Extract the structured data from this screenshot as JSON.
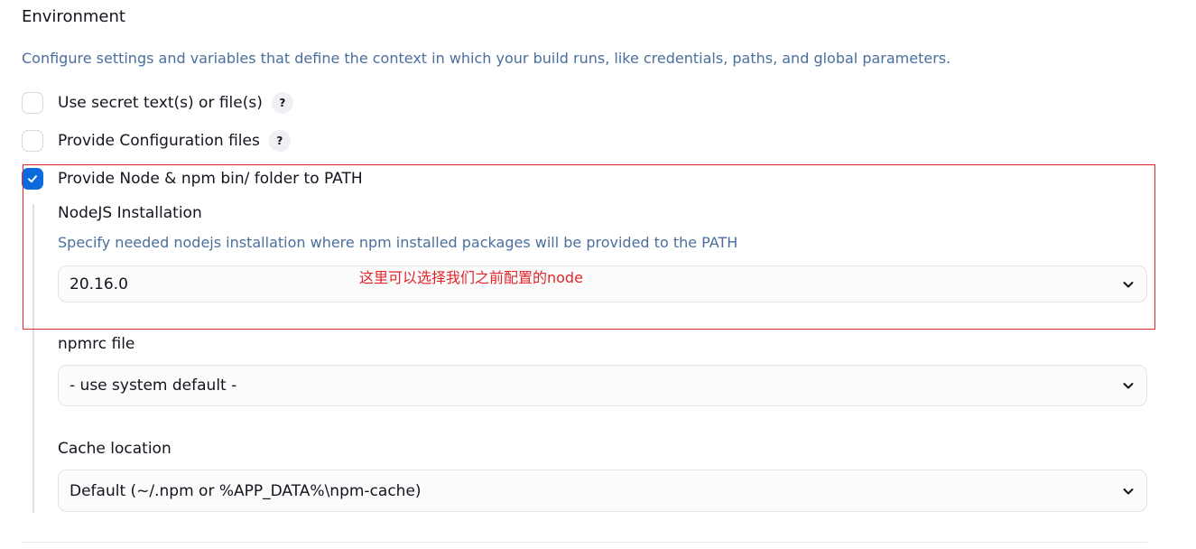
{
  "section": {
    "title": "Environment",
    "description": "Configure settings and variables that define the context in which your build runs, like credentials, paths, and global parameters."
  },
  "options": [
    {
      "label": "Use secret text(s) or file(s)",
      "checked": false,
      "help": "?"
    },
    {
      "label": "Provide Configuration files",
      "checked": false,
      "help": "?"
    },
    {
      "label": "Provide Node & npm bin/ folder to PATH",
      "checked": true
    }
  ],
  "node": {
    "installation_label": "NodeJS Installation",
    "installation_desc": "Specify needed nodejs installation where npm installed packages will be provided to the PATH",
    "installation_value": "20.16.0",
    "npmrc_label": "npmrc file",
    "npmrc_value": "- use system default -",
    "cache_label": "Cache location",
    "cache_value": "Default (~/.npm or %APP_DATA%\\npm-cache)"
  },
  "annotation": {
    "text": "这里可以选择我们之前配置的node",
    "color": "#e0262b"
  },
  "colors": {
    "accent": "#0b6bdc",
    "description": "#4a6f9d"
  },
  "icons": {
    "checkbox_check": "check-icon",
    "select_chevron": "chevron-down-icon",
    "help": "help-icon"
  }
}
